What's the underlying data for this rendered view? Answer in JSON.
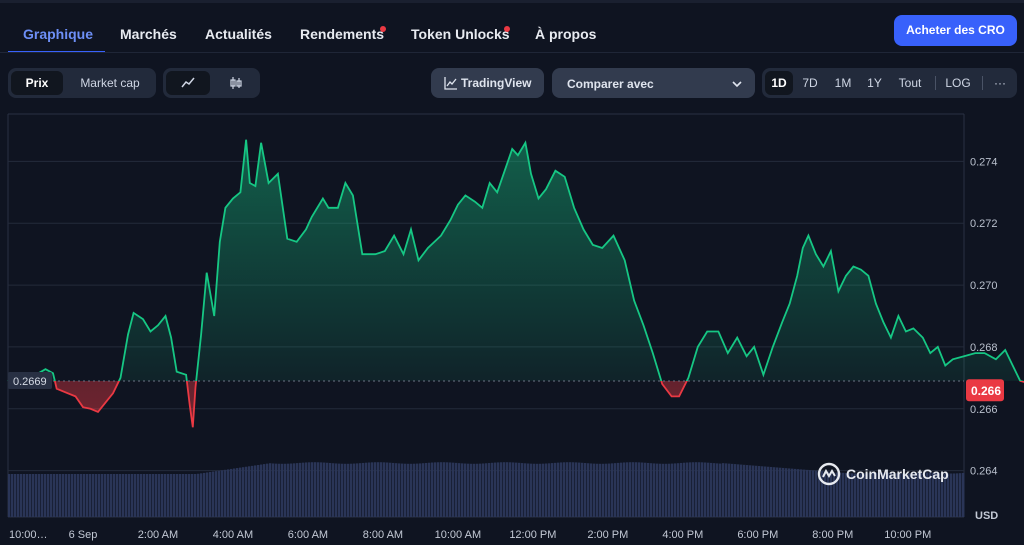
{
  "nav": {
    "tabs": [
      {
        "label": "Graphique",
        "active": true,
        "dot": false
      },
      {
        "label": "Marchés",
        "active": false,
        "dot": false
      },
      {
        "label": "Actualités",
        "active": false,
        "dot": false
      },
      {
        "label": "Rendements",
        "active": false,
        "dot": true
      },
      {
        "label": "Token Unlocks",
        "active": false,
        "dot": true
      },
      {
        "label": "À propos",
        "active": false,
        "dot": false
      }
    ],
    "buy_label": "Acheter des CRO"
  },
  "toolbar": {
    "metric_tabs": [
      "Prix",
      "Market cap"
    ],
    "metric_selected": "Prix",
    "chart_mode": "line",
    "tradingview_label": "TradingView",
    "compare_label": "Comparer avec",
    "ranges": [
      "1D",
      "7D",
      "1M",
      "1Y",
      "Tout"
    ],
    "range_selected": "1D",
    "log_label": "LOG",
    "more_label": "···"
  },
  "colors": {
    "background": "#0f1421",
    "up": "#16c784",
    "down": "#ea3943",
    "accent": "#3861fb",
    "volume": "#2a3557"
  },
  "watermark": "CoinMarketCap",
  "chart_data": {
    "type": "area",
    "currency_label": "USD",
    "open_price": 0.2669,
    "open_price_label": "0.2669",
    "current_price": 0.2666,
    "current_price_label": "0.266",
    "ylim": [
      0.2625,
      0.2755
    ],
    "y_ticks": [
      0.274,
      0.272,
      0.27,
      0.268,
      0.266,
      0.264
    ],
    "y_tick_labels": [
      "0.274",
      "0.272",
      "0.270",
      "0.268",
      "0.266",
      "0.264"
    ],
    "x_range_hours": [
      22,
      47.5
    ],
    "x_ticks": [
      22,
      24,
      26,
      28,
      30,
      32,
      34,
      36,
      38,
      40,
      42,
      44,
      46
    ],
    "x_tick_labels": [
      "10:00…",
      "6 Sep",
      "2:00 AM",
      "4:00 AM",
      "6:00 AM",
      "8:00 AM",
      "10:00 AM",
      "12:00 PM",
      "2:00 PM",
      "4:00 PM",
      "6:00 PM",
      "8:00 PM",
      "10:00 PM"
    ],
    "price_points": [
      [
        22.0,
        0.2669
      ],
      [
        22.2,
        0.267
      ],
      [
        22.4,
        0.2671
      ],
      [
        22.6,
        0.267
      ],
      [
        23.0,
        0.26728
      ],
      [
        23.2,
        0.26715
      ],
      [
        23.3,
        0.26665
      ],
      [
        23.5,
        0.26655
      ],
      [
        23.8,
        0.2664
      ],
      [
        24.0,
        0.26605
      ],
      [
        24.2,
        0.266
      ],
      [
        24.4,
        0.2659
      ],
      [
        24.6,
        0.2662
      ],
      [
        24.8,
        0.2665
      ],
      [
        25.0,
        0.267
      ],
      [
        25.2,
        0.2684
      ],
      [
        25.35,
        0.2691
      ],
      [
        25.6,
        0.2689
      ],
      [
        25.8,
        0.2685
      ],
      [
        26.0,
        0.2687
      ],
      [
        26.2,
        0.269
      ],
      [
        26.35,
        0.2683
      ],
      [
        26.5,
        0.2672
      ],
      [
        26.75,
        0.2671
      ],
      [
        26.85,
        0.2661
      ],
      [
        26.93,
        0.2654
      ],
      [
        27.0,
        0.2667
      ],
      [
        27.15,
        0.2684
      ],
      [
        27.3,
        0.2704
      ],
      [
        27.5,
        0.269
      ],
      [
        27.65,
        0.2714
      ],
      [
        27.8,
        0.2725
      ],
      [
        28.0,
        0.2728
      ],
      [
        28.2,
        0.273
      ],
      [
        28.35,
        0.2747
      ],
      [
        28.45,
        0.2733
      ],
      [
        28.6,
        0.2732
      ],
      [
        28.75,
        0.2746
      ],
      [
        28.95,
        0.2733
      ],
      [
        29.2,
        0.2736
      ],
      [
        29.45,
        0.2715
      ],
      [
        29.7,
        0.2714
      ],
      [
        29.95,
        0.2718
      ],
      [
        30.1,
        0.2722
      ],
      [
        30.4,
        0.2728
      ],
      [
        30.55,
        0.2725
      ],
      [
        30.8,
        0.2725
      ],
      [
        31.0,
        0.2733
      ],
      [
        31.2,
        0.2729
      ],
      [
        31.45,
        0.271
      ],
      [
        31.8,
        0.271
      ],
      [
        32.05,
        0.2711
      ],
      [
        32.3,
        0.2716
      ],
      [
        32.55,
        0.271
      ],
      [
        32.75,
        0.2718
      ],
      [
        32.95,
        0.2708
      ],
      [
        33.2,
        0.2712
      ],
      [
        33.55,
        0.2716
      ],
      [
        33.8,
        0.2721
      ],
      [
        34.0,
        0.2726
      ],
      [
        34.2,
        0.2729
      ],
      [
        34.45,
        0.2727
      ],
      [
        34.65,
        0.2725
      ],
      [
        34.85,
        0.2733
      ],
      [
        35.05,
        0.273
      ],
      [
        35.25,
        0.2737
      ],
      [
        35.45,
        0.2744
      ],
      [
        35.6,
        0.2742
      ],
      [
        35.8,
        0.2746
      ],
      [
        35.95,
        0.2736
      ],
      [
        36.15,
        0.2728
      ],
      [
        36.35,
        0.2731
      ],
      [
        36.6,
        0.2737
      ],
      [
        36.85,
        0.2735
      ],
      [
        37.1,
        0.2725
      ],
      [
        37.35,
        0.2718
      ],
      [
        37.6,
        0.2713
      ],
      [
        37.85,
        0.2712
      ],
      [
        38.15,
        0.2716
      ],
      [
        38.45,
        0.2708
      ],
      [
        38.7,
        0.2695
      ],
      [
        38.95,
        0.2687
      ],
      [
        39.2,
        0.2678
      ],
      [
        39.45,
        0.2668
      ],
      [
        39.7,
        0.2664
      ],
      [
        39.9,
        0.2664
      ],
      [
        40.15,
        0.267
      ],
      [
        40.4,
        0.268
      ],
      [
        40.65,
        0.2685
      ],
      [
        40.95,
        0.2685
      ],
      [
        41.2,
        0.2678
      ],
      [
        41.45,
        0.2683
      ],
      [
        41.7,
        0.2677
      ],
      [
        41.9,
        0.268
      ],
      [
        42.15,
        0.2671
      ],
      [
        42.4,
        0.268
      ],
      [
        42.65,
        0.2688
      ],
      [
        42.85,
        0.2694
      ],
      [
        43.05,
        0.2703
      ],
      [
        43.2,
        0.2712
      ],
      [
        43.35,
        0.2716
      ],
      [
        43.55,
        0.271
      ],
      [
        43.75,
        0.2706
      ],
      [
        43.95,
        0.2711
      ],
      [
        44.15,
        0.2698
      ],
      [
        44.35,
        0.2703
      ],
      [
        44.55,
        0.2706
      ],
      [
        44.75,
        0.2705
      ],
      [
        44.95,
        0.2703
      ],
      [
        45.15,
        0.2694
      ],
      [
        45.35,
        0.2688
      ],
      [
        45.55,
        0.2683
      ],
      [
        45.75,
        0.269
      ],
      [
        45.95,
        0.2685
      ],
      [
        46.15,
        0.2686
      ],
      [
        46.4,
        0.2683
      ],
      [
        46.6,
        0.2678
      ],
      [
        46.8,
        0.268
      ],
      [
        47.0,
        0.2674
      ],
      [
        47.2,
        0.2676
      ],
      [
        47.5,
        0.2677
      ],
      [
        47.8,
        0.2678
      ],
      [
        48.05,
        0.2678
      ],
      [
        48.35,
        0.2676
      ],
      [
        48.6,
        0.2679
      ],
      [
        48.8,
        0.2674
      ],
      [
        49.0,
        0.2669
      ],
      [
        49.3,
        0.2668
      ]
    ]
  }
}
